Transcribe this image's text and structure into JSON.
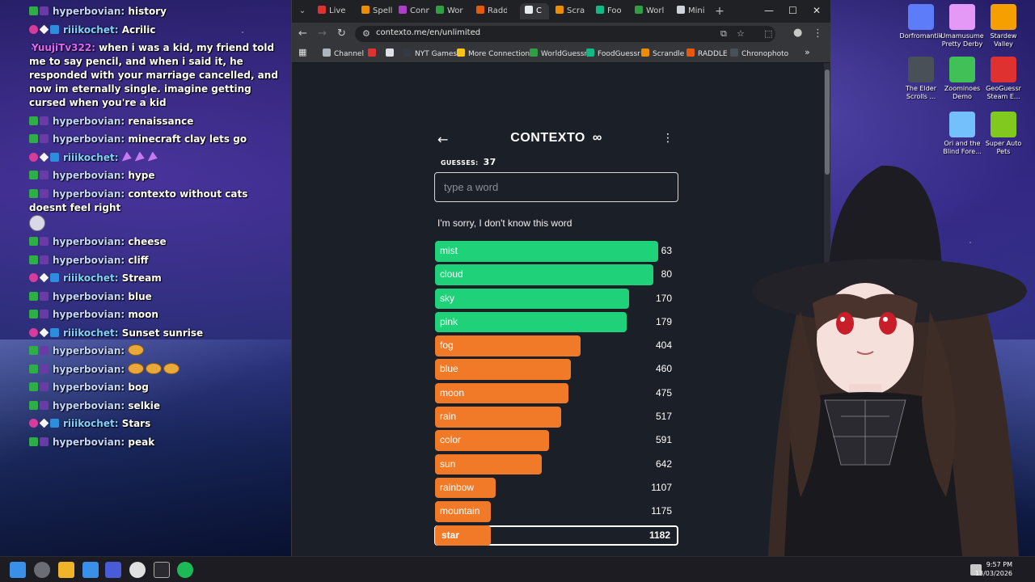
{
  "chat": [
    {
      "badges": [
        "check",
        "one"
      ],
      "user": "hyperbovian",
      "ucolor": "blue",
      "text": "history"
    },
    {
      "badges": [
        "heart",
        "star",
        "tv"
      ],
      "user": "riiikochet",
      "ucolor": "teal",
      "text": "Acrilic"
    },
    {
      "badges": [],
      "user": "YuujiTv322",
      "ucolor": "pink",
      "text": "when i was a kid, my friend told me to say pencil, and when i said it, he responded with your marriage cancelled, and now im eternally single. imagine getting cursed when you're a kid"
    },
    {
      "badges": [
        "check",
        "one"
      ],
      "user": "hyperbovian",
      "ucolor": "blue",
      "text": "renaissance"
    },
    {
      "badges": [
        "check",
        "one"
      ],
      "user": "hyperbovian",
      "ucolor": "blue",
      "text": "minecraft clay lets go"
    },
    {
      "badges": [
        "heart",
        "star",
        "tv"
      ],
      "user": "riiikochet",
      "ucolor": "teal",
      "text": "",
      "emote": "party"
    },
    {
      "badges": [
        "check",
        "one"
      ],
      "user": "hyperbovian",
      "ucolor": "blue",
      "text": "hype"
    },
    {
      "badges": [
        "check",
        "one"
      ],
      "user": "hyperbovian",
      "ucolor": "blue",
      "text": "contexto without cats doesnt feel right",
      "emote": "face"
    },
    {
      "badges": [
        "check",
        "one"
      ],
      "user": "hyperbovian",
      "ucolor": "blue",
      "text": "cheese"
    },
    {
      "badges": [
        "check",
        "one"
      ],
      "user": "hyperbovian",
      "ucolor": "blue",
      "text": "cliff"
    },
    {
      "badges": [
        "heart",
        "star",
        "tv"
      ],
      "user": "riiikochet",
      "ucolor": "teal",
      "text": "Stream"
    },
    {
      "badges": [
        "check",
        "one"
      ],
      "user": "hyperbovian",
      "ucolor": "blue",
      "text": "blue"
    },
    {
      "badges": [
        "check",
        "one"
      ],
      "user": "hyperbovian",
      "ucolor": "blue",
      "text": "moon"
    },
    {
      "badges": [
        "heart",
        "star",
        "tv"
      ],
      "user": "riiikochet",
      "ucolor": "teal",
      "text": "Sunset sunrise"
    },
    {
      "badges": [
        "check",
        "one"
      ],
      "user": "hyperbovian",
      "ucolor": "blue",
      "text": "",
      "emote": "bread1"
    },
    {
      "badges": [
        "check",
        "one"
      ],
      "user": "hyperbovian",
      "ucolor": "blue",
      "text": "",
      "emote": "bread3"
    },
    {
      "badges": [
        "check",
        "one"
      ],
      "user": "hyperbovian",
      "ucolor": "blue",
      "text": "bog"
    },
    {
      "badges": [
        "check",
        "one"
      ],
      "user": "hyperbovian",
      "ucolor": "blue",
      "text": "selkie"
    },
    {
      "badges": [
        "heart",
        "star",
        "tv"
      ],
      "user": "riiikochet",
      "ucolor": "teal",
      "text": "Stars"
    },
    {
      "badges": [
        "check",
        "one"
      ],
      "user": "hyperbovian",
      "ucolor": "blue",
      "text": "peak"
    }
  ],
  "browser": {
    "tabs": [
      {
        "label": "Live",
        "icon_color": "#e03131"
      },
      {
        "label": "Spell",
        "icon_color": "#f08c00"
      },
      {
        "label": "Conn",
        "icon_color": "#ae3ec9"
      },
      {
        "label": "Wor",
        "icon_color": "#2f9e44"
      },
      {
        "label": "Radd",
        "icon_color": "#e8590c"
      },
      {
        "label": "C",
        "icon_color": "#e9ecef"
      },
      {
        "label": "Scra",
        "icon_color": "#f08c00"
      },
      {
        "label": "Foo",
        "icon_color": "#12b886"
      },
      {
        "label": "Worl",
        "icon_color": "#2f9e44"
      },
      {
        "label": "Mini",
        "icon_color": "#ced4da"
      }
    ],
    "new_tab": "+",
    "url": "contexto.me/en/unlimited",
    "bookmarks": [
      {
        "label": "Channel",
        "icon_color": "#adb5bd"
      },
      {
        "label": "",
        "icon_color": "#e03131"
      },
      {
        "label": "",
        "icon_color": "#dee2e6"
      },
      {
        "label": "NYT Games",
        "icon_color": "#343a40"
      },
      {
        "label": "More Connections",
        "icon_color": "#fcc419"
      },
      {
        "label": "WorldGuessr",
        "icon_color": "#2f9e44"
      },
      {
        "label": "FoodGuessr",
        "icon_color": "#12b886"
      },
      {
        "label": "Scrandle",
        "icon_color": "#f08c00"
      },
      {
        "label": "RADDLE",
        "icon_color": "#e8590c"
      },
      {
        "label": "Chronophoto",
        "icon_color": "#495057"
      }
    ]
  },
  "game": {
    "title": "CONTEXTO",
    "infinity": "∞",
    "guesses_label": "GUESSES:",
    "guesses_count": "37",
    "input_placeholder": "type a word",
    "message": "I'm sorry, I don't know this word",
    "colors": {
      "green": "#1fd27a",
      "orange": "#f07a28",
      "red": "#f0456a"
    },
    "guesses": [
      {
        "word": "mist",
        "rank": "63",
        "fill": 0.92,
        "color": "green"
      },
      {
        "word": "cloud",
        "rank": "80",
        "fill": 0.9,
        "color": "green"
      },
      {
        "word": "sky",
        "rank": "170",
        "fill": 0.8,
        "color": "green"
      },
      {
        "word": "pink",
        "rank": "179",
        "fill": 0.79,
        "color": "green"
      },
      {
        "word": "fog",
        "rank": "404",
        "fill": 0.6,
        "color": "orange"
      },
      {
        "word": "blue",
        "rank": "460",
        "fill": 0.56,
        "color": "orange"
      },
      {
        "word": "moon",
        "rank": "475",
        "fill": 0.55,
        "color": "orange"
      },
      {
        "word": "rain",
        "rank": "517",
        "fill": 0.52,
        "color": "orange"
      },
      {
        "word": "color",
        "rank": "591",
        "fill": 0.47,
        "color": "orange"
      },
      {
        "word": "sun",
        "rank": "642",
        "fill": 0.44,
        "color": "orange"
      },
      {
        "word": "rainbow",
        "rank": "1107",
        "fill": 0.25,
        "color": "orange"
      },
      {
        "word": "mountain",
        "rank": "1175",
        "fill": 0.23,
        "color": "orange"
      },
      {
        "word": "star",
        "rank": "1182",
        "fill": 0.23,
        "color": "orange",
        "current": true
      }
    ]
  },
  "desktop_icons": [
    {
      "label": "Dorfromantik",
      "color": "#5c7cfa"
    },
    {
      "label": "Umamusume Pretty Derby",
      "color": "#e599f7"
    },
    {
      "label": "Stardew Valley",
      "color": "#f59f00"
    },
    {
      "label": "The Elder Scrolls ...",
      "color": "#495057"
    },
    {
      "label": "Zoominoes Demo",
      "color": "#40c057"
    },
    {
      "label": "GeoGuessr Steam E...",
      "color": "#e03131"
    },
    {
      "label": "Ori and the Blind Fore...",
      "color": "#74c0fc"
    },
    {
      "label": "Super Auto Pets",
      "color": "#82c91e"
    }
  ],
  "taskbar": {
    "time": "9:57 PM",
    "date": "13/03/2026"
  }
}
